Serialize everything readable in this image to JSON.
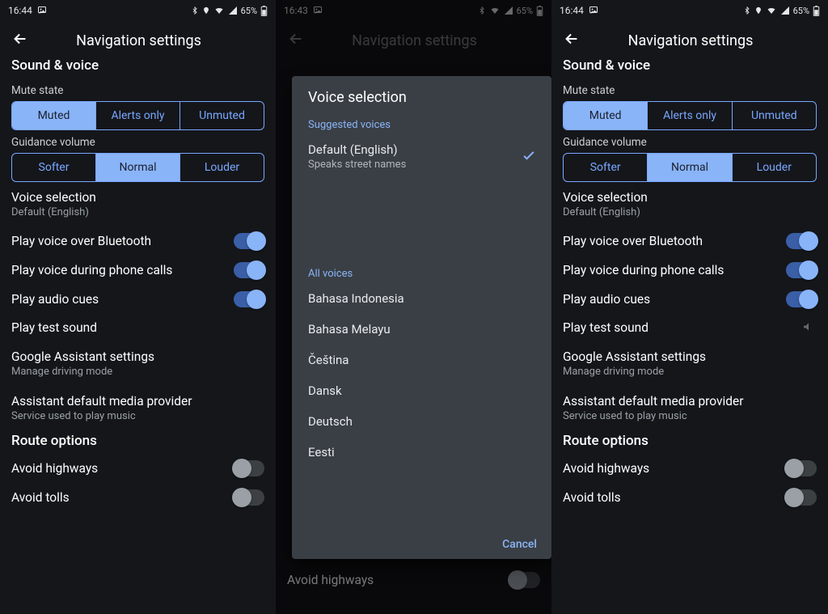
{
  "status": {
    "time_a": "16:44",
    "time_b": "16:43",
    "battery": "65%",
    "icons": {
      "picture": "🖼",
      "bt": "bluetooth",
      "loc": "location",
      "wifi": "wifi",
      "cell": "cell",
      "batt": "battery"
    }
  },
  "appbar": {
    "title": "Navigation settings"
  },
  "sections": {
    "sound_voice": "Sound & voice",
    "route_options": "Route options"
  },
  "mute": {
    "label": "Mute state",
    "options": [
      "Muted",
      "Alerts only",
      "Unmuted"
    ],
    "selected_left": 0,
    "selected_right": 0
  },
  "volume": {
    "label": "Guidance volume",
    "options": [
      "Softer",
      "Normal",
      "Louder"
    ],
    "selected_left": 1,
    "selected_right": 1
  },
  "voice_selection": {
    "title": "Voice selection",
    "value": "Default (English)"
  },
  "toggles": {
    "bt_voice": {
      "title": "Play voice over Bluetooth",
      "on": true
    },
    "during_calls": {
      "title": "Play voice during phone calls",
      "on": true
    },
    "audio_cues": {
      "title": "Play audio cues",
      "on": true
    }
  },
  "play_test": "Play test sound",
  "assistant": {
    "settings_title": "Google Assistant settings",
    "settings_sub": "Manage driving mode",
    "media_title": "Assistant default media provider",
    "media_sub": "Service used to play music"
  },
  "route": {
    "avoid_highways": {
      "title": "Avoid highways",
      "on": false
    },
    "avoid_tolls": {
      "title": "Avoid tolls",
      "on": false
    }
  },
  "dialog": {
    "title": "Voice selection",
    "suggested_header": "Suggested voices",
    "default_title": "Default (English)",
    "default_sub": "Speaks street names",
    "all_header": "All voices",
    "voices": [
      "Bahasa Indonesia",
      "Bahasa Melayu",
      "Čeština",
      "Dansk",
      "Deutsch",
      "Eesti"
    ],
    "cancel": "Cancel"
  }
}
